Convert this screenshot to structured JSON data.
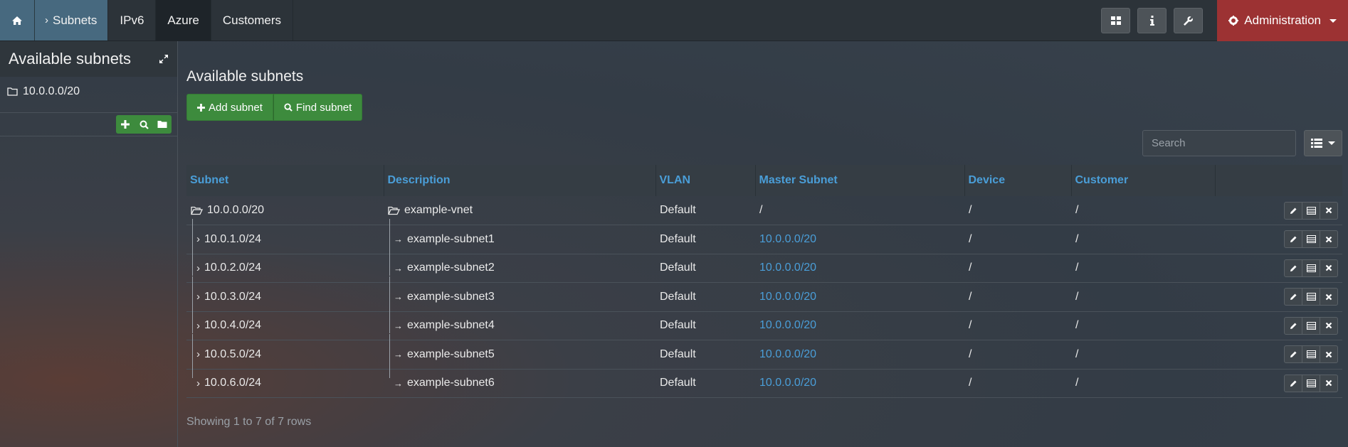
{
  "nav": {
    "items": [
      {
        "label": "Subnets"
      },
      {
        "label": "IPv6"
      },
      {
        "label": "Azure"
      },
      {
        "label": "Customers"
      }
    ],
    "admin_label": "Administration"
  },
  "sidebar": {
    "title": "Available subnets",
    "tree_item": "10.0.0.0/20"
  },
  "main": {
    "title": "Available subnets",
    "add_subnet": "Add subnet",
    "find_subnet": "Find subnet",
    "search_placeholder": "Search",
    "footer": "Showing 1 to 7 of 7 rows"
  },
  "table": {
    "headers": [
      "Subnet",
      "Description",
      "VLAN",
      "Master Subnet",
      "Device",
      "Customer"
    ],
    "rows": [
      {
        "subnet": "10.0.0.0/20",
        "description": "example-vnet",
        "vlan": "Default",
        "master": "/",
        "device": "/",
        "customer": "/"
      },
      {
        "subnet": "10.0.1.0/24",
        "description": "example-subnet1",
        "vlan": "Default",
        "master": "10.0.0.0/20",
        "device": "/",
        "customer": "/"
      },
      {
        "subnet": "10.0.2.0/24",
        "description": "example-subnet2",
        "vlan": "Default",
        "master": "10.0.0.0/20",
        "device": "/",
        "customer": "/"
      },
      {
        "subnet": "10.0.3.0/24",
        "description": "example-subnet3",
        "vlan": "Default",
        "master": "10.0.0.0/20",
        "device": "/",
        "customer": "/"
      },
      {
        "subnet": "10.0.4.0/24",
        "description": "example-subnet4",
        "vlan": "Default",
        "master": "10.0.0.0/20",
        "device": "/",
        "customer": "/"
      },
      {
        "subnet": "10.0.5.0/24",
        "description": "example-subnet5",
        "vlan": "Default",
        "master": "10.0.0.0/20",
        "device": "/",
        "customer": "/"
      },
      {
        "subnet": "10.0.6.0/24",
        "description": "example-subnet6",
        "vlan": "Default",
        "master": "10.0.0.0/20",
        "device": "/",
        "customer": "/"
      }
    ]
  },
  "colors": {
    "accent_blue": "#4a9ed8",
    "success_green": "#3d8b3d",
    "danger_red": "#9c3233",
    "nav_active": "#47697f"
  }
}
